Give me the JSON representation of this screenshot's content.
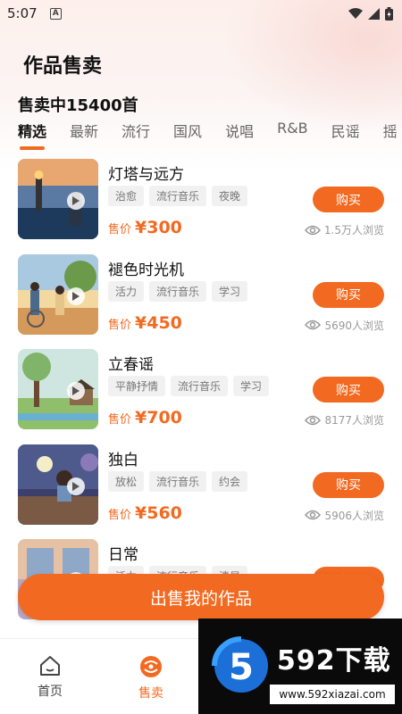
{
  "status": {
    "time": "5:07"
  },
  "page": {
    "title": "作品售卖",
    "count_text": "售卖中15400首"
  },
  "tabs": [
    "精选",
    "最新",
    "流行",
    "国风",
    "说唱",
    "R&B",
    "民谣",
    "摇"
  ],
  "items": [
    {
      "title": "灯塔与远方",
      "tags": [
        "治愈",
        "流行音乐",
        "夜晚"
      ],
      "price_label": "售价",
      "price": "¥300",
      "views": "1.5万人浏览",
      "buy": "购买"
    },
    {
      "title": "褪色时光机",
      "tags": [
        "活力",
        "流行音乐",
        "学习"
      ],
      "price_label": "售价",
      "price": "¥450",
      "views": "5690人浏览",
      "buy": "购买"
    },
    {
      "title": "立春谣",
      "tags": [
        "平静抒情",
        "流行音乐",
        "学习"
      ],
      "price_label": "售价",
      "price": "¥700",
      "views": "8177人浏览",
      "buy": "购买"
    },
    {
      "title": "独白",
      "tags": [
        "放松",
        "流行音乐",
        "约会"
      ],
      "price_label": "售价",
      "price": "¥560",
      "views": "5906人浏览",
      "buy": "购买"
    },
    {
      "title": "日常",
      "tags": [
        "活力",
        "流行音乐",
        "清晨"
      ],
      "price_label": "售价",
      "price": "",
      "views": "",
      "buy": "购买"
    }
  ],
  "sell_button": "出售我的作品",
  "nav": {
    "home": "首页",
    "sell": "售卖"
  },
  "watermark": {
    "logo": "592下载",
    "url": "www.592xiazai.com"
  },
  "colors": {
    "accent": "#f26a21"
  }
}
